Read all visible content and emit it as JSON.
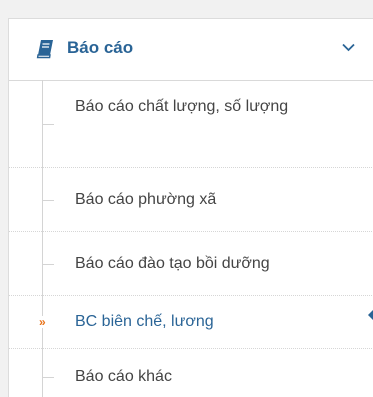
{
  "menu": {
    "header": {
      "icon": "book-icon",
      "label": "Báo cáo",
      "toggle_icon": "chevron-down-icon",
      "color": "#2a6496"
    },
    "items": [
      {
        "label": "Báo cáo chất lượng, số lượng",
        "active": false
      },
      {
        "label": "Báo cáo phường xã",
        "active": false
      },
      {
        "label": "Báo cáo đào tạo bồi dưỡng",
        "active": false
      },
      {
        "label": "BC biên chế, lương",
        "active": true,
        "marker": "»"
      },
      {
        "label": "Báo cáo khác",
        "active": false
      }
    ],
    "active_marker_color": "#e8731a"
  }
}
